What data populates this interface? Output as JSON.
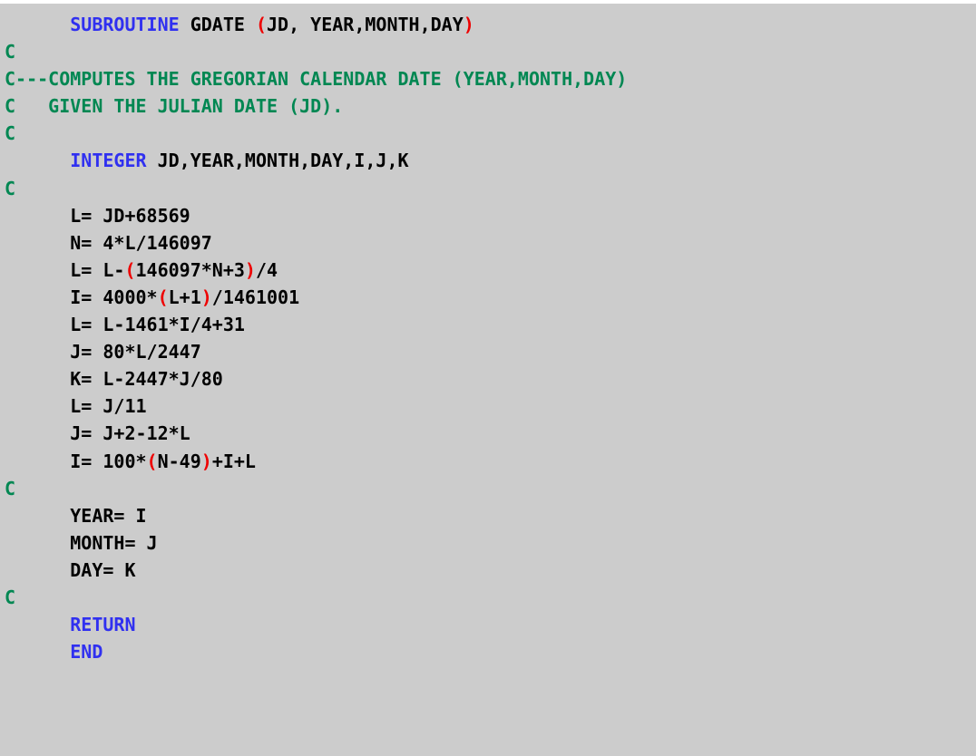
{
  "editor": {
    "background_color": "#cccccc",
    "language": "FORTRAN",
    "colors": {
      "keyword": "#3030f0",
      "comment": "#008752",
      "paren": "#ee0000",
      "identifier": "#000000"
    }
  },
  "code": {
    "lines": [
      {
        "id": "line-1",
        "tokens": [
          {
            "t": "plain",
            "v": "      "
          },
          {
            "t": "kw",
            "v": "SUBROUTINE"
          },
          {
            "t": "id",
            "v": " GDATE "
          },
          {
            "t": "par",
            "v": "("
          },
          {
            "t": "id",
            "v": "JD, YEAR,MONTH,DAY"
          },
          {
            "t": "par",
            "v": ")"
          }
        ]
      },
      {
        "id": "line-2",
        "tokens": [
          {
            "t": "cmt",
            "v": "C"
          }
        ]
      },
      {
        "id": "line-3",
        "tokens": [
          {
            "t": "cmt",
            "v": "C---COMPUTES THE GREGORIAN CALENDAR DATE (YEAR,MONTH,DAY)"
          }
        ]
      },
      {
        "id": "line-4",
        "tokens": [
          {
            "t": "cmt",
            "v": "C   GIVEN THE JULIAN DATE (JD)."
          }
        ]
      },
      {
        "id": "line-5",
        "tokens": [
          {
            "t": "cmt",
            "v": "C"
          }
        ]
      },
      {
        "id": "line-6",
        "tokens": [
          {
            "t": "plain",
            "v": "      "
          },
          {
            "t": "kw",
            "v": "INTEGER"
          },
          {
            "t": "id",
            "v": " JD,YEAR,MONTH,DAY,I,J,K"
          }
        ]
      },
      {
        "id": "line-7",
        "tokens": [
          {
            "t": "cmt",
            "v": "C"
          }
        ]
      },
      {
        "id": "line-8",
        "tokens": [
          {
            "t": "plain",
            "v": "      L= JD+68569"
          }
        ]
      },
      {
        "id": "line-9",
        "tokens": [
          {
            "t": "plain",
            "v": "      N= 4*L/146097"
          }
        ]
      },
      {
        "id": "line-10",
        "tokens": [
          {
            "t": "plain",
            "v": "      L= L-"
          },
          {
            "t": "par",
            "v": "("
          },
          {
            "t": "plain",
            "v": "146097*N+3"
          },
          {
            "t": "par",
            "v": ")"
          },
          {
            "t": "plain",
            "v": "/4"
          }
        ]
      },
      {
        "id": "line-11",
        "tokens": [
          {
            "t": "plain",
            "v": "      I= 4000*"
          },
          {
            "t": "par",
            "v": "("
          },
          {
            "t": "plain",
            "v": "L+1"
          },
          {
            "t": "par",
            "v": ")"
          },
          {
            "t": "plain",
            "v": "/1461001"
          }
        ]
      },
      {
        "id": "line-12",
        "tokens": [
          {
            "t": "plain",
            "v": "      L= L-1461*I/4+31"
          }
        ]
      },
      {
        "id": "line-13",
        "tokens": [
          {
            "t": "plain",
            "v": "      J= 80*L/2447"
          }
        ]
      },
      {
        "id": "line-14",
        "tokens": [
          {
            "t": "plain",
            "v": "      K= L-2447*J/80"
          }
        ]
      },
      {
        "id": "line-15",
        "tokens": [
          {
            "t": "plain",
            "v": "      L= J/11"
          }
        ]
      },
      {
        "id": "line-16",
        "tokens": [
          {
            "t": "plain",
            "v": "      J= J+2-12*L"
          }
        ]
      },
      {
        "id": "line-17",
        "tokens": [
          {
            "t": "plain",
            "v": "      I= 100*"
          },
          {
            "t": "par",
            "v": "("
          },
          {
            "t": "plain",
            "v": "N-49"
          },
          {
            "t": "par",
            "v": ")"
          },
          {
            "t": "plain",
            "v": "+I+L"
          }
        ]
      },
      {
        "id": "line-18",
        "tokens": [
          {
            "t": "cmt",
            "v": "C"
          }
        ]
      },
      {
        "id": "line-19",
        "tokens": [
          {
            "t": "plain",
            "v": "      YEAR= I"
          }
        ]
      },
      {
        "id": "line-20",
        "tokens": [
          {
            "t": "plain",
            "v": "      MONTH= J"
          }
        ]
      },
      {
        "id": "line-21",
        "tokens": [
          {
            "t": "plain",
            "v": "      DAY= K"
          }
        ]
      },
      {
        "id": "line-22",
        "tokens": [
          {
            "t": "cmt",
            "v": "C"
          }
        ]
      },
      {
        "id": "line-23",
        "tokens": [
          {
            "t": "plain",
            "v": "      "
          },
          {
            "t": "kw",
            "v": "RETURN"
          }
        ]
      },
      {
        "id": "line-24",
        "tokens": [
          {
            "t": "plain",
            "v": "      "
          },
          {
            "t": "kw",
            "v": "END"
          }
        ]
      }
    ]
  }
}
